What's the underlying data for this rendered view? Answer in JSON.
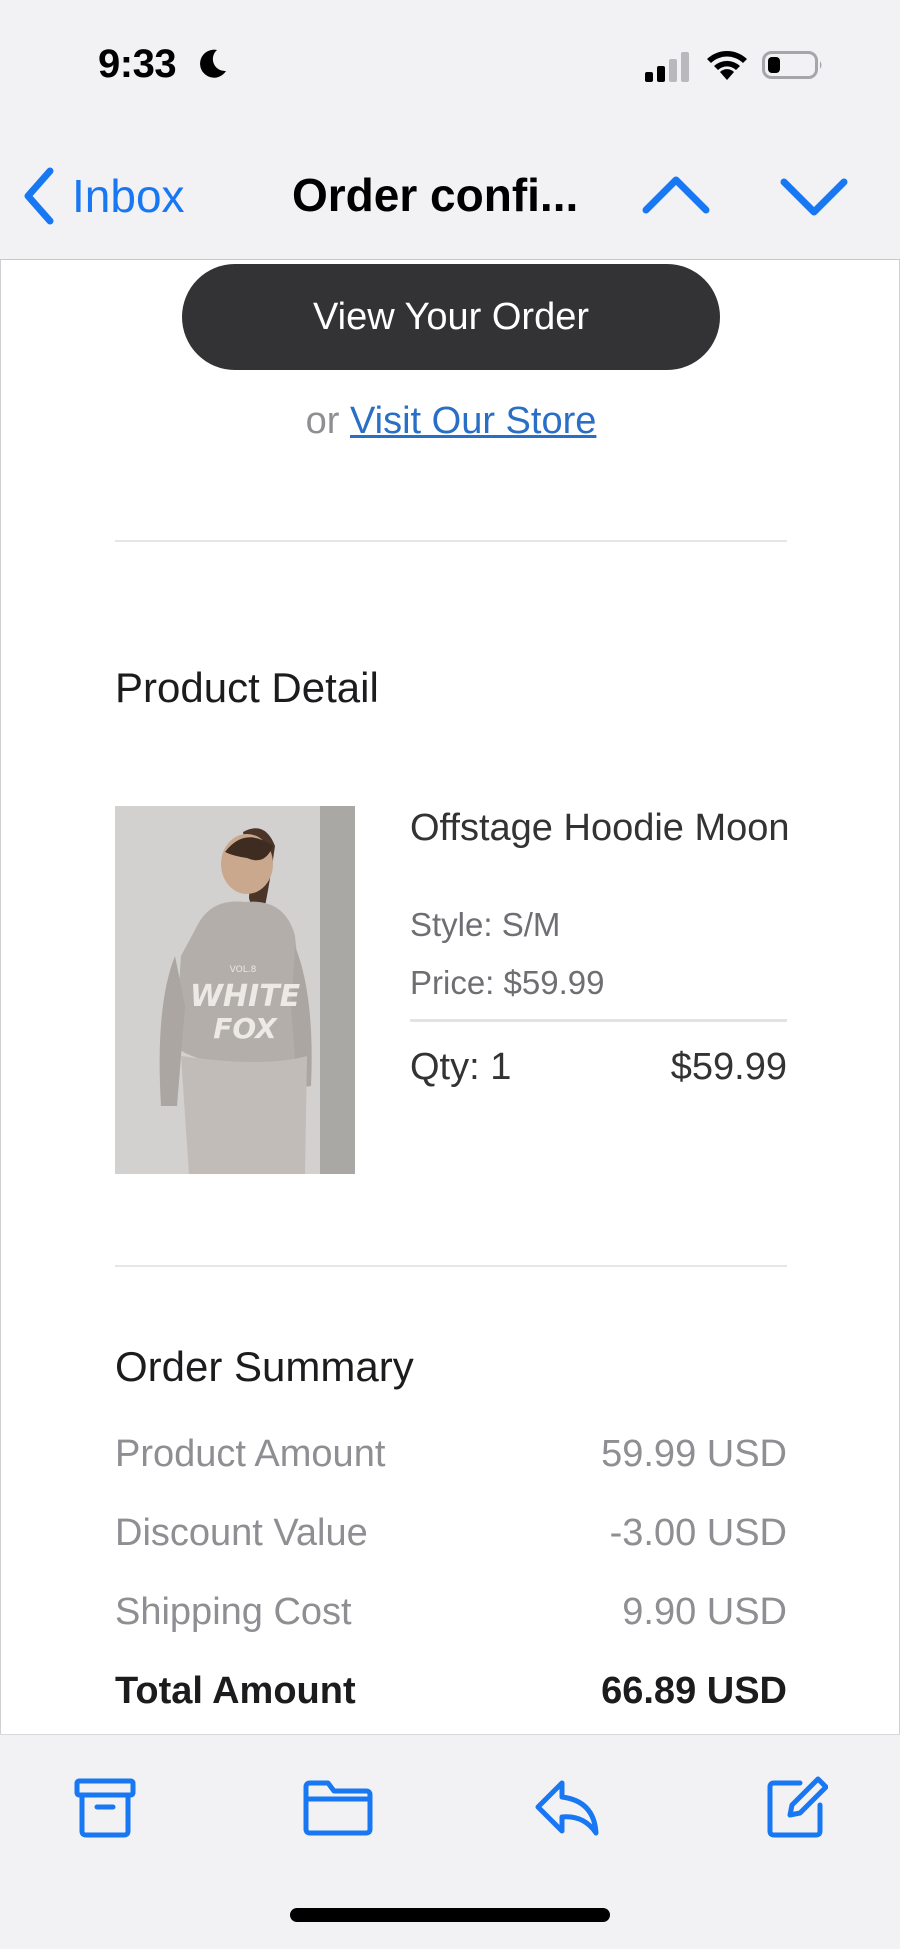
{
  "status_bar": {
    "time": "9:33",
    "icons": [
      "moon-icon",
      "cellular-signal-icon",
      "wifi-icon",
      "battery-icon"
    ]
  },
  "nav": {
    "back_label": "Inbox",
    "title": "Order confi...",
    "accent_color": "#1877f2"
  },
  "email": {
    "view_order_label": "View Your Order",
    "or_text": "or",
    "visit_store_label": "Visit Our Store",
    "product_section_title": "Product Detail",
    "product": {
      "name": "Offstage Hoodie Moon",
      "style": "Style: S/M",
      "price": "Price: $59.99",
      "qty": "Qty: 1",
      "line_total": "$59.99",
      "image_text_top": "VOL.8",
      "image_text_main": "WHITE",
      "image_text_sub": "FOX"
    },
    "summary_title": "Order Summary",
    "summary": [
      {
        "label": "Product Amount",
        "value": "59.99 USD"
      },
      {
        "label": "Discount Value",
        "value": "-3.00 USD"
      },
      {
        "label": "Shipping Cost",
        "value": "9.90 USD"
      },
      {
        "label": "Total Amount",
        "value": "66.89 USD"
      }
    ]
  },
  "toolbar": {
    "items": [
      "archive-icon",
      "folder-icon",
      "reply-icon",
      "compose-icon"
    ]
  }
}
